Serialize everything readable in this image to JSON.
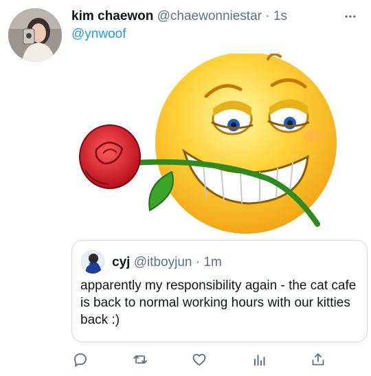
{
  "tweet": {
    "display_name": "kim chaewon",
    "handle": "@chaewonniestar",
    "separator": "·",
    "time": "1s",
    "reply_to": "@ynwoof",
    "more_icon": "more-horizontal-icon"
  },
  "media": {
    "description_icon": "smirking-emoji-with-rose"
  },
  "quoted_tweet": {
    "display_name": "cyj",
    "handle": "@itboyjun",
    "separator": "·",
    "time": "1m",
    "text": "apparently my responsibility again - the cat cafe is back to normal working hours with our kitties back :)"
  },
  "actions": [
    {
      "name": "reply-button",
      "icon": "comment-icon"
    },
    {
      "name": "retweet-button",
      "icon": "retweet-icon"
    },
    {
      "name": "like-button",
      "icon": "heart-icon"
    },
    {
      "name": "analytics-button",
      "icon": "bar-chart-icon"
    },
    {
      "name": "share-button",
      "icon": "share-icon"
    }
  ],
  "colors": {
    "link": "#1d9bf0",
    "muted": "#5b7083",
    "border": "#cfd9de"
  }
}
